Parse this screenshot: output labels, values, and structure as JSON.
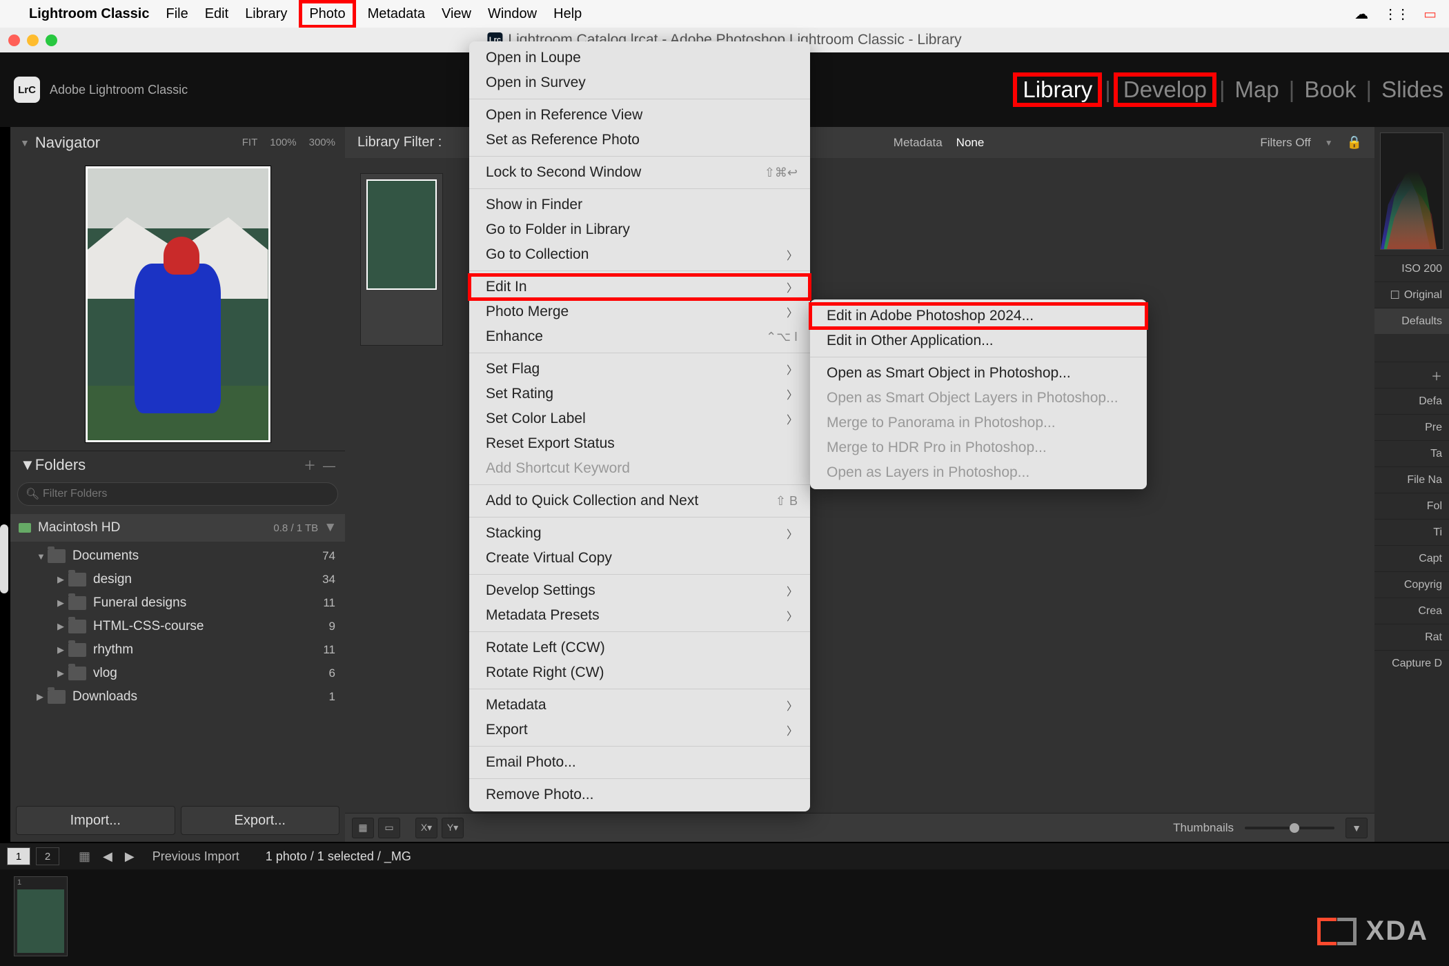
{
  "menubar": {
    "app_name": "Lightroom Classic",
    "items": [
      "File",
      "Edit",
      "Library",
      "Photo",
      "Metadata",
      "View",
      "Window",
      "Help"
    ],
    "highlighted": "Photo"
  },
  "titlebar": {
    "title": "Lightroom Catalog.lrcat - Adobe Photoshop Lightroom Classic - Library"
  },
  "header": {
    "logo_text": "LrC",
    "product": "Adobe Lightroom Classic",
    "modules": [
      "Library",
      "Develop",
      "Map",
      "Book",
      "Slides"
    ],
    "active_module": "Library",
    "highlighted_modules": [
      "Library",
      "Develop"
    ]
  },
  "navigator": {
    "title": "Navigator",
    "zoom": [
      "FIT",
      "100%",
      "300%"
    ]
  },
  "folders": {
    "title": "Folders",
    "filter_placeholder": "Filter Folders",
    "disk": {
      "name": "Macintosh HD",
      "info": "0.8 / 1 TB"
    },
    "tree": [
      {
        "depth": 1,
        "name": "Documents",
        "count": "74",
        "expanded": true
      },
      {
        "depth": 2,
        "name": "design",
        "count": "34"
      },
      {
        "depth": 2,
        "name": "Funeral designs",
        "count": "11"
      },
      {
        "depth": 2,
        "name": "HTML-CSS-course",
        "count": "9"
      },
      {
        "depth": 2,
        "name": "rhythm",
        "count": "11"
      },
      {
        "depth": 2,
        "name": "vlog",
        "count": "6"
      },
      {
        "depth": 1,
        "name": "Downloads",
        "count": "1"
      }
    ],
    "import_btn": "Import...",
    "export_btn": "Export..."
  },
  "library_filter": {
    "label": "Library Filter :",
    "metadata": "Metadata",
    "none": "None",
    "filters_off": "Filters Off"
  },
  "toolbar": {
    "thumbnails_label": "Thumbnails"
  },
  "right_panel": {
    "iso": "ISO 200",
    "original": "Original",
    "defaults": "Defaults",
    "rows": [
      "Defa",
      "Pre",
      "Ta",
      "File Na",
      "Fol",
      "Ti",
      "Capt",
      "Copyrig",
      "Crea",
      "Rat",
      "Capture D"
    ]
  },
  "filmstrip": {
    "status": "Previous Import",
    "count": "1 photo / 1 selected / _MG"
  },
  "dropdown_main": [
    {
      "label": "Open in Loupe"
    },
    {
      "label": "Open in Survey"
    },
    {
      "sep": true
    },
    {
      "label": "Open in Reference View"
    },
    {
      "label": "Set as Reference Photo"
    },
    {
      "sep": true
    },
    {
      "label": "Lock to Second Window",
      "shortcut": "⇧⌘↩"
    },
    {
      "sep": true
    },
    {
      "label": "Show in Finder"
    },
    {
      "label": "Go to Folder in Library"
    },
    {
      "label": "Go to Collection",
      "submenu": true
    },
    {
      "sep": true
    },
    {
      "label": "Edit In",
      "submenu": true,
      "highlight": true
    },
    {
      "label": "Photo Merge",
      "submenu": true
    },
    {
      "label": "Enhance",
      "shortcut": "⌃⌥ I"
    },
    {
      "sep": true
    },
    {
      "label": "Set Flag",
      "submenu": true
    },
    {
      "label": "Set Rating",
      "submenu": true
    },
    {
      "label": "Set Color Label",
      "submenu": true
    },
    {
      "label": "Reset Export Status"
    },
    {
      "label": "Add Shortcut Keyword",
      "disabled": true
    },
    {
      "sep": true
    },
    {
      "label": "Add to Quick Collection and Next",
      "shortcut": "⇧ B"
    },
    {
      "sep": true
    },
    {
      "label": "Stacking",
      "submenu": true
    },
    {
      "label": "Create Virtual Copy"
    },
    {
      "sep": true
    },
    {
      "label": "Develop Settings",
      "submenu": true
    },
    {
      "label": "Metadata Presets",
      "submenu": true
    },
    {
      "sep": true
    },
    {
      "label": "Rotate Left (CCW)"
    },
    {
      "label": "Rotate Right (CW)"
    },
    {
      "sep": true
    },
    {
      "label": "Metadata",
      "submenu": true
    },
    {
      "label": "Export",
      "submenu": true
    },
    {
      "sep": true
    },
    {
      "label": "Email Photo..."
    },
    {
      "sep": true
    },
    {
      "label": "Remove Photo..."
    }
  ],
  "dropdown_sub": [
    {
      "label": "Edit in Adobe Photoshop 2024...",
      "highlight": true
    },
    {
      "label": "Edit in Other Application..."
    },
    {
      "sep": true
    },
    {
      "label": "Open as Smart Object in Photoshop..."
    },
    {
      "label": "Open as Smart Object Layers in Photoshop...",
      "disabled": true
    },
    {
      "label": "Merge to Panorama in Photoshop...",
      "disabled": true
    },
    {
      "label": "Merge to HDR Pro in Photoshop...",
      "disabled": true
    },
    {
      "label": "Open as Layers in Photoshop...",
      "disabled": true
    }
  ],
  "watermark": "XDA"
}
